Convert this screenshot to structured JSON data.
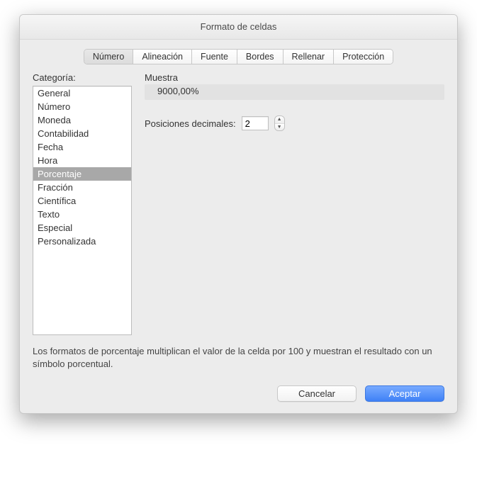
{
  "title": "Formato de celdas",
  "tabs": [
    "Número",
    "Alineación",
    "Fuente",
    "Bordes",
    "Rellenar",
    "Protección"
  ],
  "active_tab_index": 0,
  "category_label": "Categoría:",
  "categories": [
    "General",
    "Número",
    "Moneda",
    "Contabilidad",
    "Fecha",
    "Hora",
    "Porcentaje",
    "Fracción",
    "Científica",
    "Texto",
    "Especial",
    "Personalizada"
  ],
  "selected_category_index": 6,
  "sample_label": "Muestra",
  "sample_value": "9000,00%",
  "decimal_label": "Posiciones decimales:",
  "decimal_value": "2",
  "description": "Los formatos de porcentaje multiplican el valor de la celda por 100 y muestran el resultado con un símbolo porcentual.",
  "buttons": {
    "cancel": "Cancelar",
    "ok": "Aceptar"
  }
}
